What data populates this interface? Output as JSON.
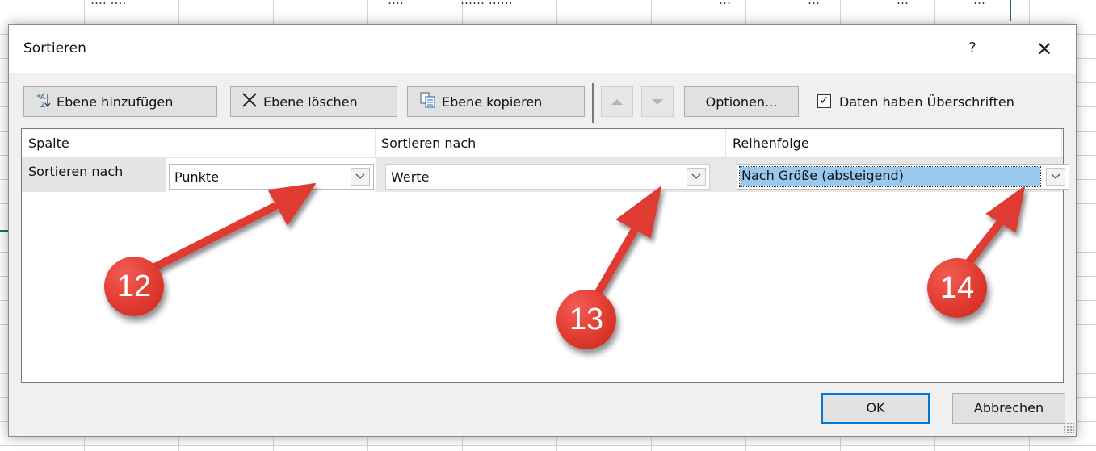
{
  "background": {
    "top_strip": [
      "….  ….",
      "….",
      "…… ……",
      "…",
      "…",
      "…",
      "…"
    ]
  },
  "dialog": {
    "title": "Sortieren",
    "help_label": "?",
    "close_label": "✕",
    "toolbar": {
      "add_level": "Ebene hinzufügen",
      "delete_level": "Ebene löschen",
      "copy_level": "Ebene kopieren",
      "options": "Optionen...",
      "has_headers_checked": true,
      "has_headers_label": "Daten haben Überschriften",
      "check_mark": "✓"
    },
    "grid": {
      "headers": [
        "Spalte",
        "Sortieren nach",
        "Reihenfolge"
      ],
      "rows": [
        {
          "label": "Sortieren nach",
          "column": "Punkte",
          "sort_on": "Werte",
          "order": "Nach Größe (absteigend)"
        }
      ]
    },
    "ok_label": "OK",
    "cancel_label": "Abbrechen"
  },
  "annotations": {
    "color": "#e03b30",
    "badges": [
      "12",
      "13",
      "14"
    ]
  }
}
